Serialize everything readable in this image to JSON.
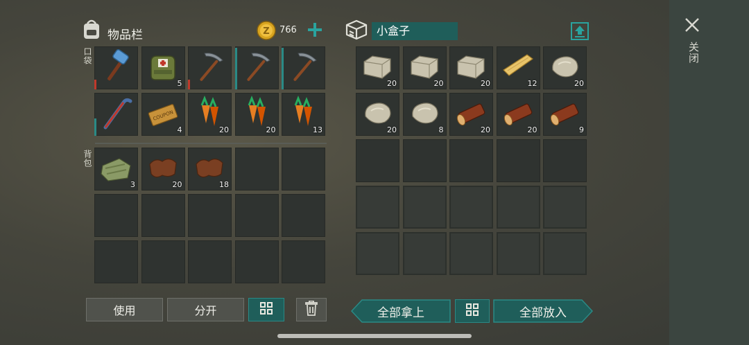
{
  "inventory": {
    "title": "物品栏",
    "coins": "766",
    "pocket_label": "口袋",
    "backpack_label": "背包",
    "pocket_slots": [
      {
        "item": "hammer",
        "qty": "",
        "dur": "red"
      },
      {
        "item": "medical-bag",
        "qty": "5",
        "dur": ""
      },
      {
        "item": "pickaxe",
        "qty": "",
        "dur": "red"
      },
      {
        "item": "pickaxe",
        "qty": "",
        "dur": "teal"
      },
      {
        "item": "pickaxe",
        "qty": "",
        "dur": "teal"
      },
      {
        "item": "crowbar",
        "qty": "",
        "dur": "teal-short"
      },
      {
        "item": "coupon",
        "qty": "4",
        "dur": ""
      },
      {
        "item": "carrots",
        "qty": "20",
        "dur": ""
      },
      {
        "item": "carrots",
        "qty": "20",
        "dur": ""
      },
      {
        "item": "carrots",
        "qty": "13",
        "dur": ""
      }
    ],
    "backpack_slots": [
      {
        "item": "cloth",
        "qty": "3"
      },
      {
        "item": "leather",
        "qty": "20"
      },
      {
        "item": "leather",
        "qty": "18"
      },
      {
        "item": "",
        "qty": ""
      },
      {
        "item": "",
        "qty": ""
      },
      {
        "item": "",
        "qty": ""
      },
      {
        "item": "",
        "qty": ""
      },
      {
        "item": "",
        "qty": ""
      },
      {
        "item": "",
        "qty": ""
      },
      {
        "item": "",
        "qty": ""
      },
      {
        "item": "",
        "qty": ""
      },
      {
        "item": "",
        "qty": ""
      },
      {
        "item": "",
        "qty": ""
      },
      {
        "item": "",
        "qty": ""
      },
      {
        "item": "",
        "qty": ""
      }
    ],
    "buttons": {
      "use": "使用",
      "split": "分开"
    }
  },
  "container": {
    "title": "小盒子",
    "slots": [
      {
        "item": "stone-block",
        "qty": "20"
      },
      {
        "item": "stone-block",
        "qty": "20"
      },
      {
        "item": "stone-block",
        "qty": "20"
      },
      {
        "item": "plank",
        "qty": "12"
      },
      {
        "item": "stone",
        "qty": "20"
      },
      {
        "item": "stone",
        "qty": "20"
      },
      {
        "item": "stone",
        "qty": "8"
      },
      {
        "item": "log",
        "qty": "20"
      },
      {
        "item": "log",
        "qty": "20"
      },
      {
        "item": "log",
        "qty": "9"
      }
    ],
    "buttons": {
      "take_all": "全部拿上",
      "put_all": "全部放入"
    }
  },
  "close_label": "关闭",
  "colors": {
    "accent": "#2a8a86",
    "accent_dark": "#1f5e5a",
    "durability_red": "#c0392b"
  },
  "icons": [
    "backpack-icon",
    "coin-icon",
    "plus-icon",
    "box-icon",
    "upload-icon",
    "close-icon",
    "sort-grid-icon",
    "trash-icon"
  ]
}
